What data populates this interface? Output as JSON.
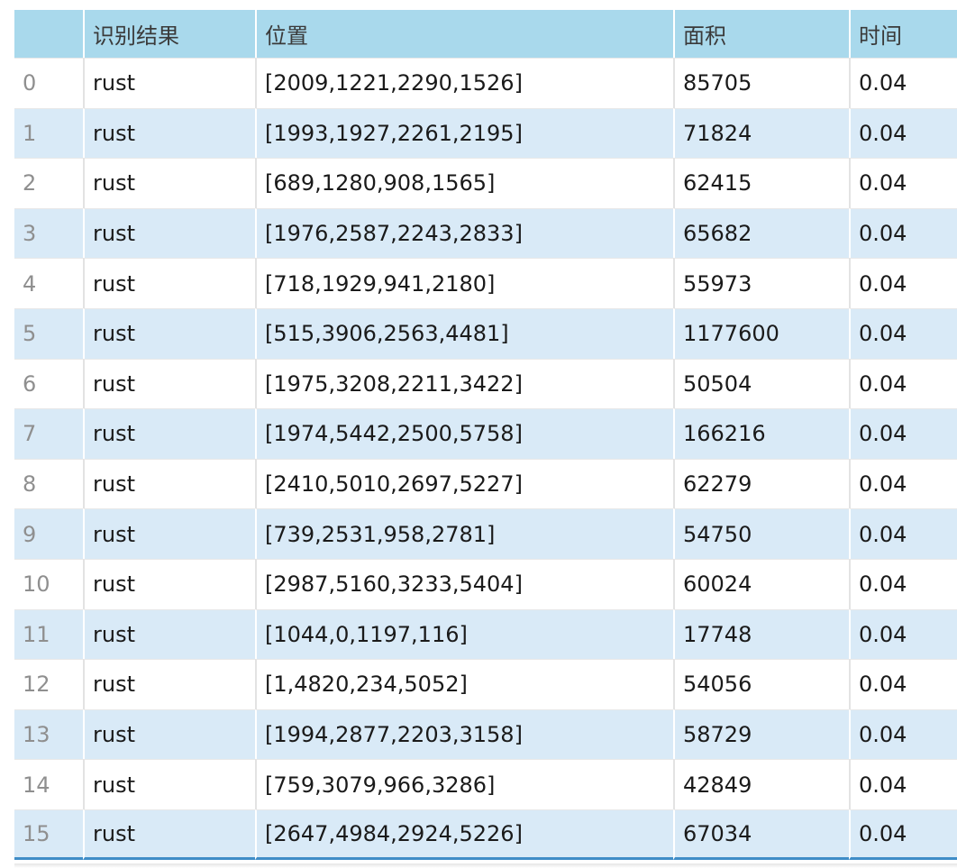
{
  "table": {
    "headers": [
      "",
      "识别结果",
      "位置",
      "面积",
      "时间"
    ],
    "rows": [
      [
        "0",
        "rust",
        "[2009,1221,2290,1526]",
        "85705",
        "0.04"
      ],
      [
        "1",
        "rust",
        "[1993,1927,2261,2195]",
        "71824",
        "0.04"
      ],
      [
        "2",
        "rust",
        "[689,1280,908,1565]",
        "62415",
        "0.04"
      ],
      [
        "3",
        "rust",
        "[1976,2587,2243,2833]",
        "65682",
        "0.04"
      ],
      [
        "4",
        "rust",
        "[718,1929,941,2180]",
        "55973",
        "0.04"
      ],
      [
        "5",
        "rust",
        "[515,3906,2563,4481]",
        "1177600",
        "0.04"
      ],
      [
        "6",
        "rust",
        "[1975,3208,2211,3422]",
        "50504",
        "0.04"
      ],
      [
        "7",
        "rust",
        "[1974,5442,2500,5758]",
        "166216",
        "0.04"
      ],
      [
        "8",
        "rust",
        "[2410,5010,2697,5227]",
        "62279",
        "0.04"
      ],
      [
        "9",
        "rust",
        "[739,2531,958,2781]",
        "54750",
        "0.04"
      ],
      [
        "10",
        "rust",
        "[2987,5160,3233,5404]",
        "60024",
        "0.04"
      ],
      [
        "11",
        "rust",
        "[1044,0,1197,116]",
        "17748",
        "0.04"
      ],
      [
        "12",
        "rust",
        "[1,4820,234,5052]",
        "54056",
        "0.04"
      ],
      [
        "13",
        "rust",
        "[1994,2877,2203,3158]",
        "58729",
        "0.04"
      ],
      [
        "14",
        "rust",
        "[759,3079,966,3286]",
        "42849",
        "0.04"
      ],
      [
        "15",
        "rust",
        "[2647,4984,2924,5226]",
        "67034",
        "0.04"
      ]
    ]
  },
  "colors": {
    "header_bg": "#a9d9ec",
    "odd_row_bg": "#d9eaf7",
    "even_row_bg": "#ffffff",
    "bottom_border": "#3f8dc7"
  }
}
